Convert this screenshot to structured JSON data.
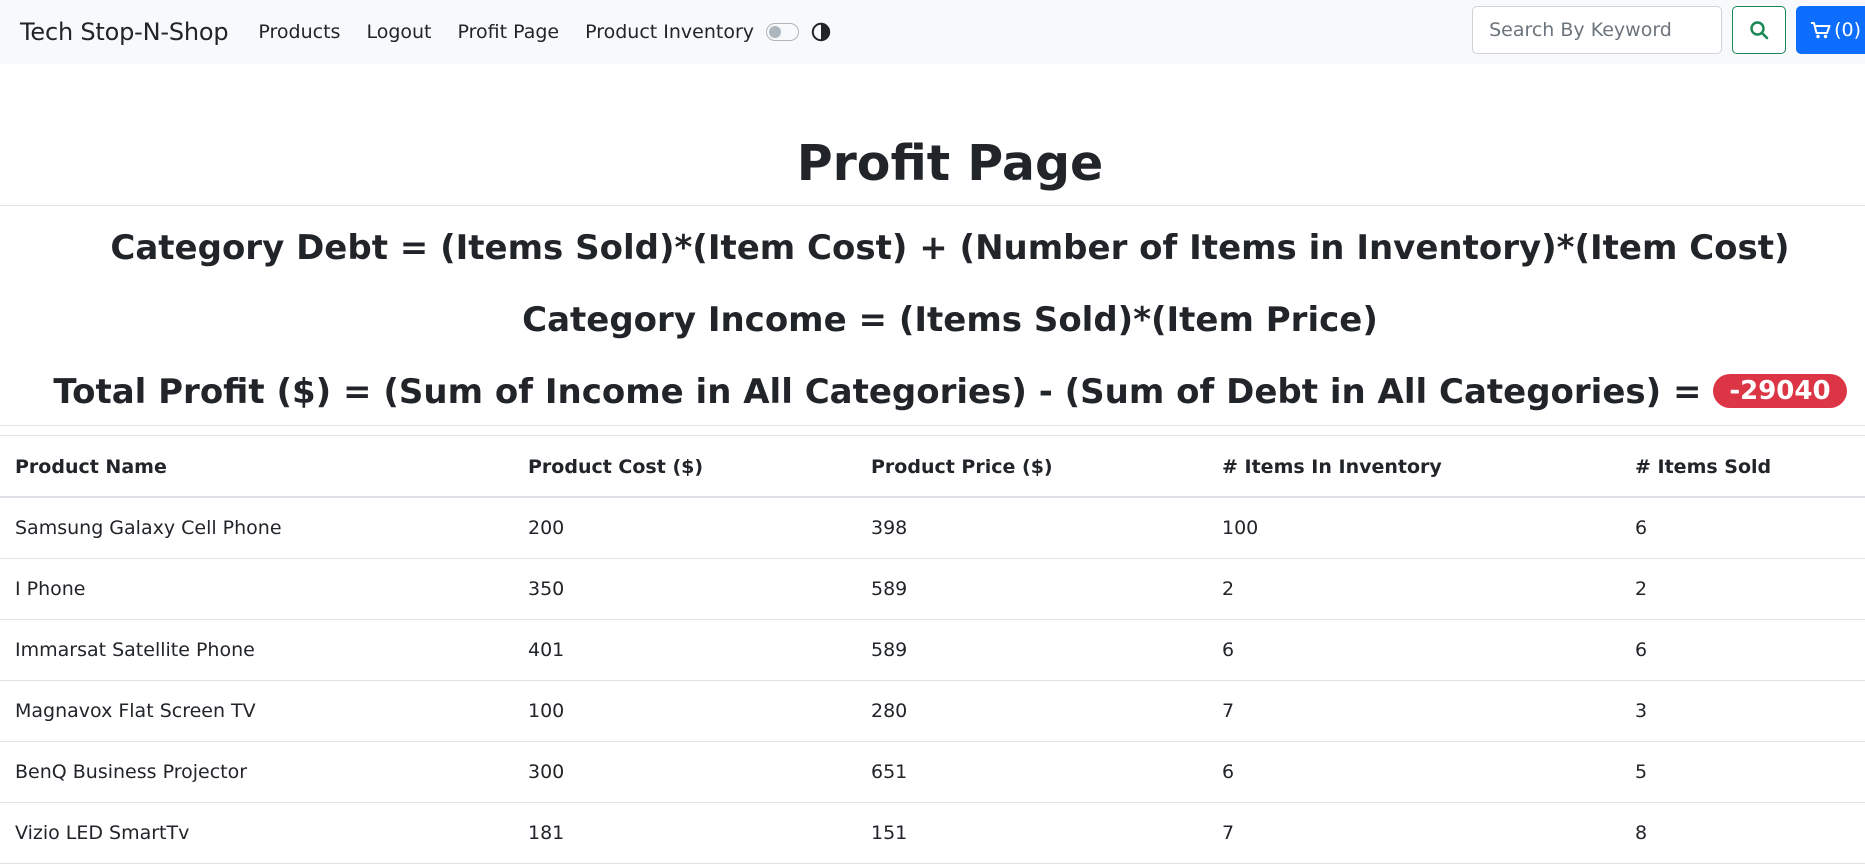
{
  "navbar": {
    "brand": "Tech Stop-N-Shop",
    "links": [
      "Products",
      "Logout",
      "Profit Page",
      "Product Inventory"
    ],
    "search_placeholder": "Search By Keyword",
    "cart_label": "(0)"
  },
  "page": {
    "title": "Profit Page",
    "formula_debt": "Category Debt = (Items Sold)*(Item Cost) + (Number of Items in Inventory)*(Item Cost)",
    "formula_income": "Category Income = (Items Sold)*(Item Price)",
    "formula_profit": "Total Profit ($) = (Sum of Income in All Categories) - (Sum of Debt in All Categories) =",
    "total_profit": "-29040"
  },
  "table": {
    "headers": [
      "Product Name",
      "Product Cost ($)",
      "Product Price ($)",
      "# Items In Inventory",
      "# Items Sold"
    ],
    "rows": [
      [
        "Samsung Galaxy Cell Phone",
        "200",
        "398",
        "100",
        "6"
      ],
      [
        "I Phone",
        "350",
        "589",
        "2",
        "2"
      ],
      [
        "Immarsat Satellite Phone",
        "401",
        "589",
        "6",
        "6"
      ],
      [
        "Magnavox Flat Screen TV",
        "100",
        "280",
        "7",
        "3"
      ],
      [
        "BenQ Business Projector",
        "300",
        "651",
        "6",
        "5"
      ],
      [
        "Vizio LED SmartTv",
        "181",
        "151",
        "7",
        "8"
      ]
    ]
  },
  "colors": {
    "navbar_bg": "#f8f9fa",
    "cart_button": "#0d6efd",
    "search_button_border": "#198754",
    "profit_badge": "#dc3545"
  },
  "icons": {
    "toggle": "switch-icon",
    "theme": "contrast-icon",
    "search": "search-icon",
    "cart": "cart-icon"
  }
}
